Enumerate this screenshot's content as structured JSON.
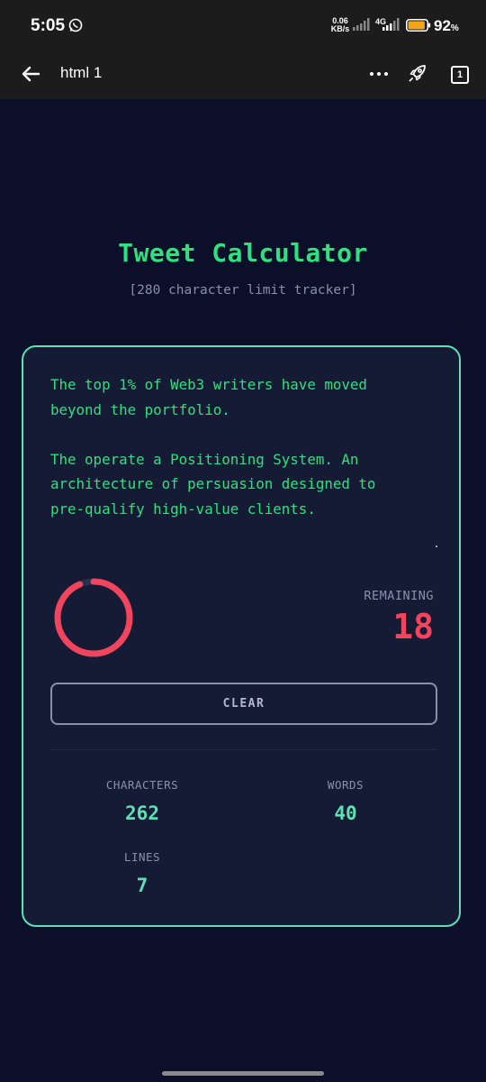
{
  "status_bar": {
    "time": "5:05",
    "speed_value": "0.06",
    "speed_unit": "KB/s",
    "network": "4G",
    "battery_percent": "92",
    "battery_unit": "%",
    "battery_level": 0.92
  },
  "app_bar": {
    "title": "html 1",
    "tab_count": "1"
  },
  "page": {
    "title": "Tweet Calculator",
    "subtitle": "[280 character limit tracker]"
  },
  "editor": {
    "text": "The top 1% of Web3 writers have moved\nbeyond the portfolio.\n\nThe operate a Positioning System. An\narchitecture of persuasion designed to\npre-qualify high-value clients."
  },
  "counter": {
    "remaining_label": "REMAINING",
    "remaining_value": "18",
    "progress": 0.936,
    "ring_color": "#f0455c"
  },
  "actions": {
    "clear_label": "CLEAR"
  },
  "stats": {
    "characters_label": "CHARACTERS",
    "characters_value": "262",
    "words_label": "WORDS",
    "words_value": "40",
    "lines_label": "LINES",
    "lines_value": "7"
  },
  "colors": {
    "background": "#0b0f2a",
    "accent_green": "#2ee07e",
    "accent_teal": "#5ee0b5",
    "warning_red": "#f0455c"
  }
}
